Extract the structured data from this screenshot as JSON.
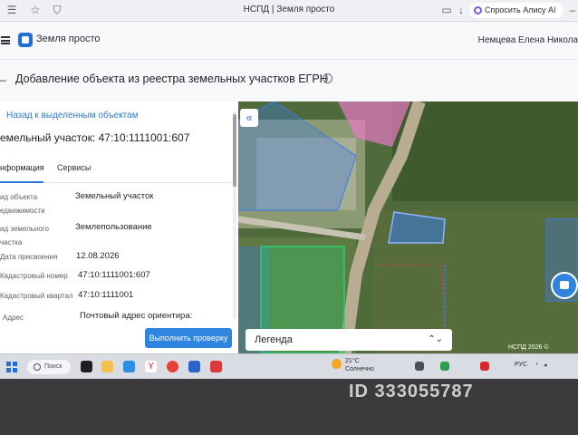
{
  "browser": {
    "tab_title": "НСПД | Земля просто",
    "alice_label": "Спросить Алису AI"
  },
  "app": {
    "name": "Земля просто",
    "user": "Немцева Елена Никола"
  },
  "page": {
    "title": "Добавление объекта из реестра земельных участков ЕГРН"
  },
  "panel": {
    "back_link": "Назад к выделенным объектам",
    "object_name": "емельный участок: 47:10:1111001:607",
    "tabs": [
      {
        "label": "нформация",
        "active": true
      },
      {
        "label": "Сервисы",
        "active": false
      }
    ],
    "rows": [
      {
        "label_1": "ид объекта",
        "label_2": "едвижимости",
        "value": "Земельный участок"
      },
      {
        "label_1": "ид земельного",
        "label_2": "частка",
        "value": "Землепользование"
      },
      {
        "label_1": "Дата присвоения",
        "label_2": "",
        "value": "12.08.2026"
      },
      {
        "label_1": "Кадастровый номер",
        "label_2": "",
        "value": "47:10:1111001:607"
      },
      {
        "label_1": "Кадастровый квартал",
        "label_2": "",
        "value": "47:10:1111001"
      },
      {
        "label_1": "Адрес",
        "label_2": "",
        "value": "Почтовый адрес ориентира:"
      }
    ],
    "check_button": "Выполнить проверку"
  },
  "map": {
    "collapse_icon": "double-chevron-left-icon",
    "legend_label": "Легенда",
    "copyright": "НСПД 2026 ©"
  },
  "taskbar": {
    "search_label": "Поиск",
    "weather_temp": "21°C",
    "weather_desc": "Солнечно",
    "language": "РУС"
  },
  "watermark": "ID 333055787",
  "colors": {
    "accent": "#2f84e0",
    "parcel_blue": "#3b7be8",
    "parcel_green": "#2ecc71",
    "parcel_pink": "#e879c6"
  }
}
